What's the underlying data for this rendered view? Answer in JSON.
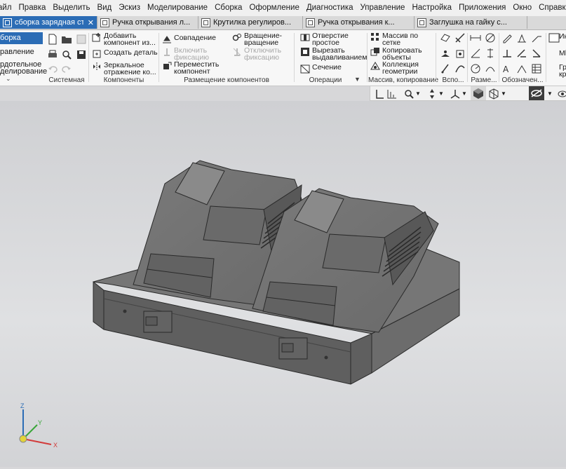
{
  "menu": [
    "айл",
    "Правка",
    "Выделить",
    "Вид",
    "Эскиз",
    "Моделирование",
    "Сборка",
    "Оформление",
    "Диагностика",
    "Управление",
    "Настройка",
    "Приложения",
    "Окно",
    "Справка"
  ],
  "doc_tabs": [
    {
      "label": "сборка зарядная ст...",
      "active": true
    },
    {
      "label": "Ручка открывания л...",
      "active": false
    },
    {
      "label": "Крутилка регулиров...",
      "active": false
    },
    {
      "label": "Ручка открывания к...",
      "active": false
    },
    {
      "label": "Заглушка на гайку с...",
      "active": false
    }
  ],
  "side_panel": {
    "active": "борка",
    "items": [
      "равление",
      "рдотельное",
      "делирование"
    ]
  },
  "groups": {
    "system": "Системная",
    "components": "Компоненты",
    "placement": "Размещение компонентов",
    "operations": "Операции",
    "array": "Массив, копирование",
    "aux": "Вспо...",
    "dims": "Разме...",
    "notation": "Обозначен..."
  },
  "components_buttons": {
    "add": "Добавить компонент из...",
    "create": "Создать деталь",
    "mirror": "Зеркальное отражение ко..."
  },
  "placement_buttons": {
    "match": "Совпадение",
    "fix": "Включить фиксацию",
    "move": "Переместить компонент",
    "rotate": "Вращение-вращение",
    "unfix": "Отключить фиксацию"
  },
  "operations_buttons": {
    "hole": "Отверстие простое",
    "cut": "Вырезать выдавливанием",
    "section": "Сечение"
  },
  "array_buttons": {
    "grid": "Массив по сетке",
    "copy": "Копировать объекты",
    "collection": "Коллекция геометрии"
  },
  "far_right": [
    "Ин",
    "Ml",
    "Гр",
    "кр"
  ],
  "triad": {
    "x": "X",
    "y": "Y",
    "z": "Z"
  },
  "colors": {
    "accent": "#2b6cb5",
    "model": "#6e6e6e",
    "viewport": "#d7d7d9"
  }
}
